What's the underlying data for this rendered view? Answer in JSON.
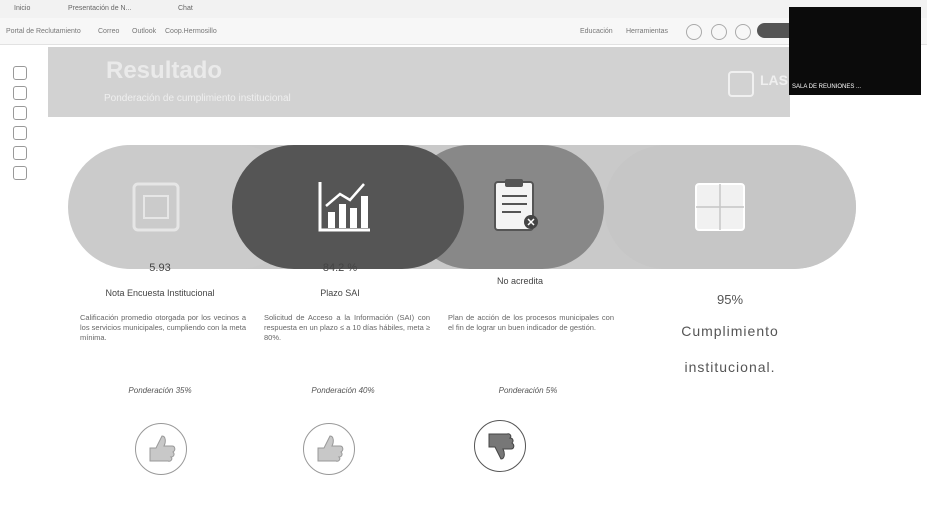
{
  "browser": {
    "tab1": "Inicio",
    "tab2": "Presentación de N...",
    "tab3": "Chat",
    "bookmarks": [
      "Portal de Reclutamiento",
      "Correo",
      "Outlook",
      "Coop.Hermosillo"
    ],
    "bookmarks_right": [
      "Educación",
      "Herramientas"
    ],
    "overlay_caption": "SALA DE REUNIONES ..."
  },
  "banner": {
    "title": "Resultado",
    "subtitle": "Ponderación de cumplimiento institucional",
    "logo": "LAS"
  },
  "items": [
    {
      "value": "5.93",
      "title": "Nota Encuesta Institucional",
      "description": "Calificación promedio otorgada por los vecinos a los servicios municipales, cumpliendo con la meta mínima.",
      "weight": "Ponderación 35%",
      "thumb": "thumbs-up-icon"
    },
    {
      "value": "84.2 %",
      "title": "Plazo SAI",
      "description": "Solicitud de Acceso a la Información (SAI) con respuesta en un plazo ≤ a 10 días hábiles, meta ≥ 80%.",
      "weight": "Ponderación 40%",
      "thumb": "thumbs-up-icon"
    },
    {
      "value": "",
      "title": "No acredita",
      "description": "Plan de acción de los procesos municipales con el fin de lograr un buen indicador de gestión.",
      "weight": "Ponderación 5%",
      "thumb": "thumbs-down-icon"
    }
  ],
  "summary": {
    "percent": "95%",
    "line1": "Cumplimiento",
    "line2": "institucional."
  },
  "colors": {
    "band": "#c9c9c9",
    "circle_dark": "#555555",
    "circle_mid": "#888888",
    "banner": "#d2d2d2"
  }
}
